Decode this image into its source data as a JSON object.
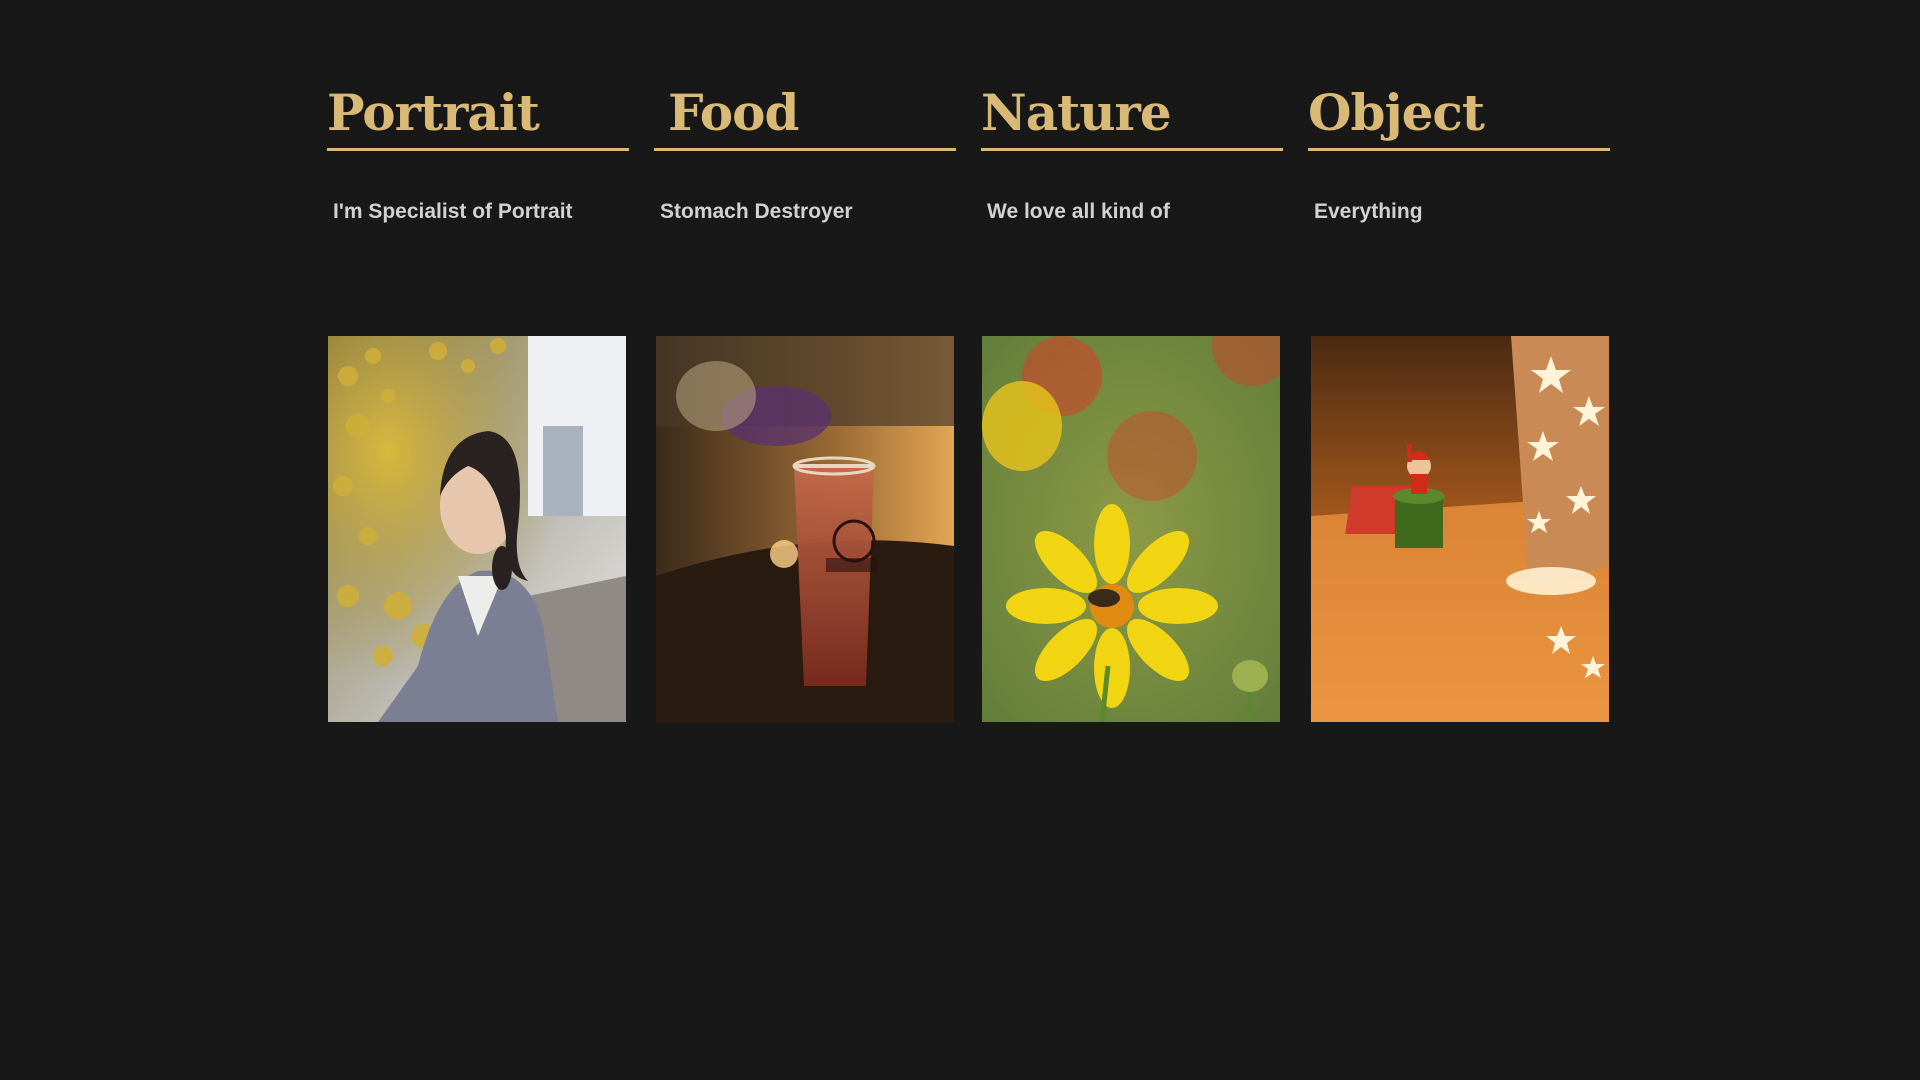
{
  "categories": [
    {
      "title": "Portrait",
      "subtitle": "I'm Specialist of Portrait",
      "image": "portrait-photo"
    },
    {
      "title": "Food",
      "subtitle": "Stomach Destroyer",
      "image": "food-photo"
    },
    {
      "title": "Nature",
      "subtitle": "We love all kind of",
      "image": "nature-photo"
    },
    {
      "title": "Object",
      "subtitle": "Everything",
      "image": "object-photo"
    }
  ],
  "colors": {
    "background": "#181818",
    "accent": "#d8b976",
    "subtitle_text": "#d2d2d2"
  }
}
